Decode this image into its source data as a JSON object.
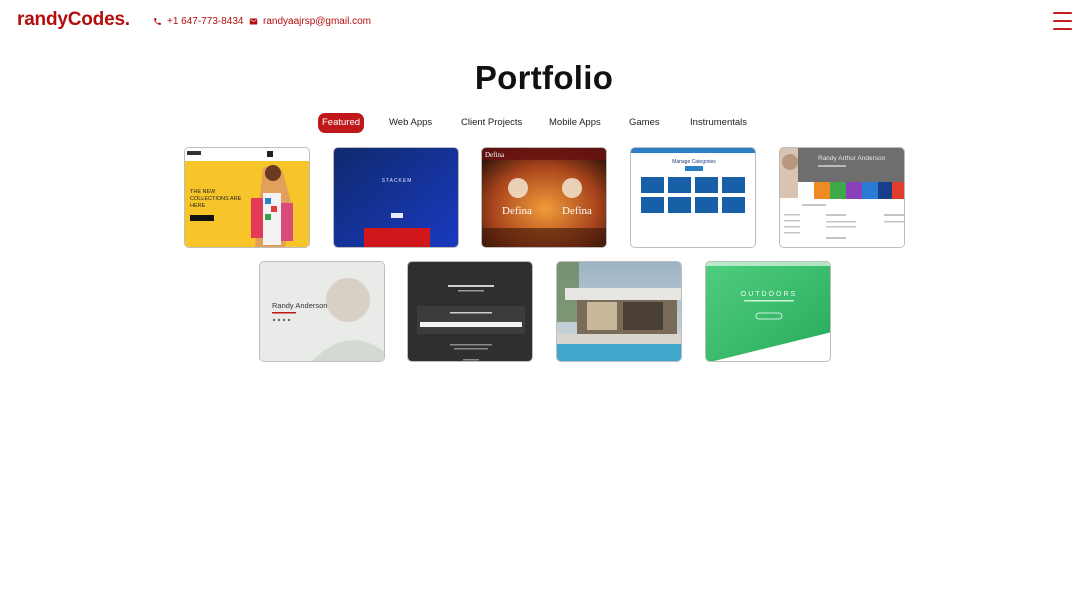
{
  "header": {
    "brand": "randyCodes.",
    "phone": "+1 647-773-8434",
    "email": "randyaajrsp@gmail.com"
  },
  "page": {
    "title": "Portfolio"
  },
  "filters": [
    {
      "label": "Featured",
      "active": true
    },
    {
      "label": "Web Apps",
      "active": false
    },
    {
      "label": "Client Projects",
      "active": false
    },
    {
      "label": "Mobile Apps",
      "active": false
    },
    {
      "label": "Games",
      "active": false
    },
    {
      "label": "Instrumentals",
      "active": false
    }
  ],
  "colors": {
    "accent": "#c0171a"
  },
  "projects": [
    {
      "id": "fashion",
      "texts": [
        "THE NEW",
        "COLLECTIONS ARE",
        "HERE"
      ]
    },
    {
      "id": "stackem",
      "texts": [
        "STACKEM"
      ]
    },
    {
      "id": "defina",
      "texts": [
        "Defina",
        "Defina",
        "Defina"
      ]
    },
    {
      "id": "categories",
      "texts": [
        "Manage Categories"
      ]
    },
    {
      "id": "profile",
      "texts": [
        "Randy Arthur Anderson"
      ]
    },
    {
      "id": "portrait",
      "texts": [
        "Randy Anderson"
      ]
    },
    {
      "id": "dark-form",
      "texts": []
    },
    {
      "id": "house",
      "texts": []
    },
    {
      "id": "outdoors",
      "texts": [
        "OUTDOORS"
      ]
    }
  ]
}
